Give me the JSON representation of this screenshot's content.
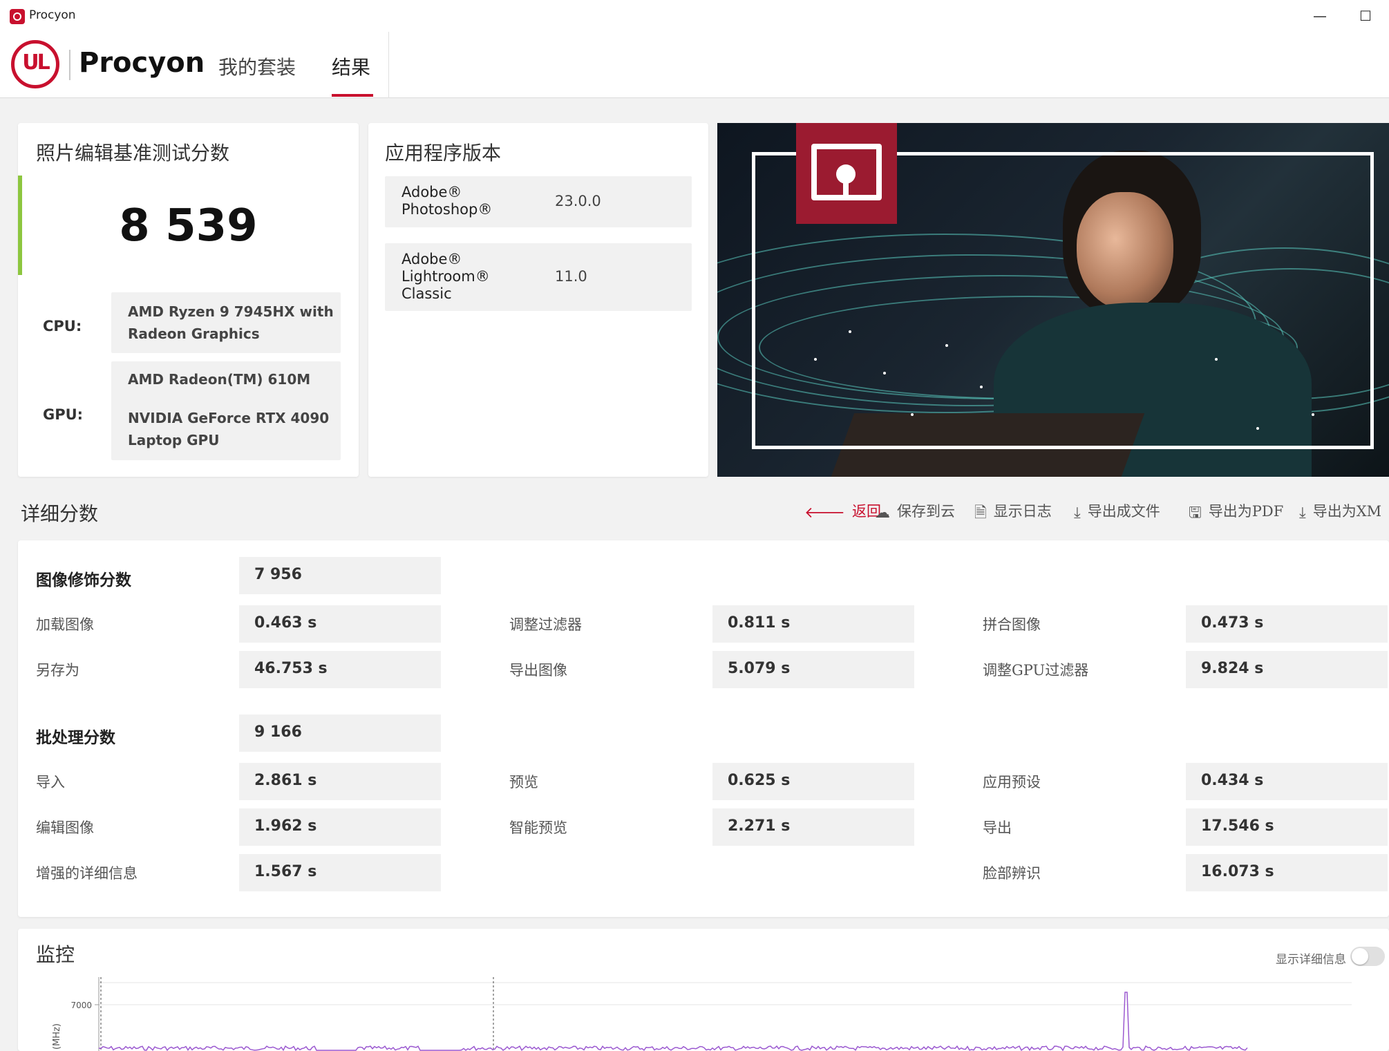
{
  "window": {
    "title": "Procyon",
    "minimize_symbol": "—",
    "maximize_symbol": "☐"
  },
  "header": {
    "logo_text": "UL",
    "brand": "Procyon",
    "tabs": [
      {
        "label": "我的套装",
        "active": false
      },
      {
        "label": "结果",
        "active": true
      }
    ]
  },
  "score_card": {
    "title": "照片编辑基准测试分数",
    "score": "8 539",
    "cpu_label": "CPU:",
    "cpu_value": [
      "AMD Ryzen 9 7945HX with",
      "Radeon Graphics"
    ],
    "gpu_label": "GPU:",
    "gpu_values": [
      "AMD Radeon(TM) 610M",
      "NVIDIA GeForce RTX 4090",
      "Laptop GPU"
    ]
  },
  "version_card": {
    "title": "应用程序版本",
    "apps": [
      {
        "name_lines": [
          "Adobe®",
          "Photoshop®"
        ],
        "version": "23.0.0"
      },
      {
        "name_lines": [
          "Adobe®",
          "Lightroom®",
          "Classic"
        ],
        "version": "11.0"
      }
    ]
  },
  "details": {
    "title": "详细分数",
    "toolbar": [
      {
        "label": "返回",
        "icon": "back-arrow-icon",
        "glyph": "🡐"
      },
      {
        "label": "保存到云",
        "icon": "cloud-upload-icon",
        "glyph": "☁"
      },
      {
        "label": "显示日志",
        "icon": "document-icon",
        "glyph": "🗎"
      },
      {
        "label": "导出成文件",
        "icon": "download-icon",
        "glyph": "⤓"
      },
      {
        "label": "导出为PDF",
        "icon": "save-icon",
        "glyph": "🖫"
      },
      {
        "label": "导出为XM",
        "icon": "download-icon",
        "glyph": "⤓"
      }
    ],
    "image_retouching": {
      "label": "图像修饰分数",
      "score": "7 956",
      "items": [
        {
          "label": "加载图像",
          "value": "0.463 s"
        },
        {
          "label": "调整过滤器",
          "value": "0.811 s"
        },
        {
          "label": "拼合图像",
          "value": "0.473 s"
        },
        {
          "label": "另存为",
          "value": "46.753 s"
        },
        {
          "label": "导出图像",
          "value": "5.079 s"
        },
        {
          "label": "调整GPU过滤器",
          "value": "9.824 s"
        }
      ]
    },
    "batch_processing": {
      "label": "批处理分数",
      "score": "9 166",
      "items": [
        {
          "label": "导入",
          "value": "2.861 s"
        },
        {
          "label": "预览",
          "value": "0.625 s"
        },
        {
          "label": "应用预设",
          "value": "0.434 s"
        },
        {
          "label": "编辑图像",
          "value": "1.962 s"
        },
        {
          "label": "智能预览",
          "value": "2.271 s"
        },
        {
          "label": "导出",
          "value": "17.546 s"
        },
        {
          "label": "增强的详细信息",
          "value": "1.567 s"
        },
        {
          "label": "脸部辨识",
          "value": "16.073 s"
        }
      ]
    }
  },
  "monitoring": {
    "title": "监控",
    "toggle_label": "显示详细信息",
    "toggle_on": false
  },
  "chart_data": {
    "type": "line",
    "title": "",
    "ylabel": "(MHz)",
    "yticks": [
      7000
    ],
    "series": [
      {
        "color": "#9b59d0"
      }
    ],
    "markers": [
      "dashed vertical at start",
      "dashed vertical at mid"
    ],
    "colors": {
      "line": "#9b59d0",
      "accent": "#c8102e",
      "green_accent": "#8dc63f"
    }
  }
}
